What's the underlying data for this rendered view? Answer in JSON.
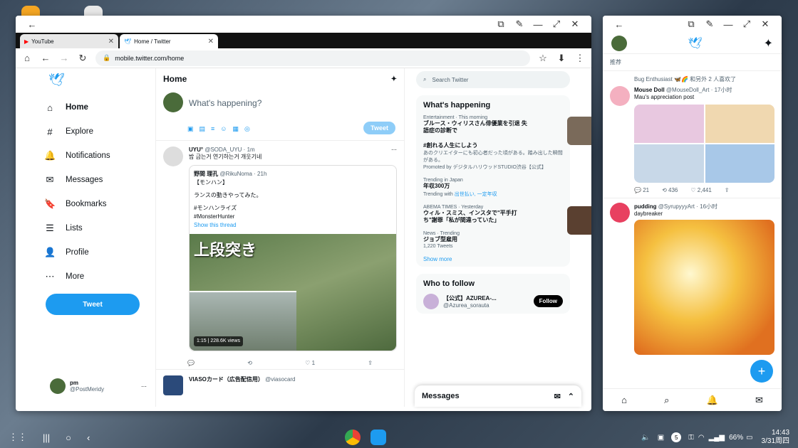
{
  "desktop": {
    "colors": {
      "accent": "#1d9bf0"
    }
  },
  "browser": {
    "tabs": [
      {
        "title": "YouTube",
        "icon": "youtube-icon"
      },
      {
        "title": "Home / Twitter",
        "icon": "twitter-icon"
      }
    ],
    "url": "mobile.twitter.com/home"
  },
  "twitter": {
    "nav": [
      "Home",
      "Explore",
      "Notifications",
      "Messages",
      "Bookmarks",
      "Lists",
      "Profile",
      "More"
    ],
    "tweet_button": "Tweet",
    "me": {
      "name": "pm",
      "handle": "@PostMeridy"
    },
    "feed_title": "Home",
    "compose_placeholder": "What's happening?",
    "compose_button": "Tweet",
    "tweet1": {
      "name": "UYU°",
      "handle": "@SODA_UYU · 1m",
      "text": "밤 금는거 연기하는거 개웃기네"
    },
    "quote": {
      "name": "野間 理孔",
      "handle": "@RikuNoma · 21h",
      "l1": "【モンハン】",
      "l2": "ランスの動きやってみた。",
      "l3": "#モンハンライズ",
      "l4": "#MonsterHunter",
      "show": "Show this thread",
      "overlay": "上段突き",
      "views": "1:15 | 228.6K views"
    },
    "tweet1_actions": {
      "likes": "1"
    },
    "tweet2": {
      "name": "VIASOカード（広告配信用）",
      "handle": "@viasocard"
    },
    "search_placeholder": "Search Twitter",
    "whats_happening": "What's happening",
    "trends": [
      {
        "sub": "Entertainment · This morning",
        "title": "ブルース・ウィリスさん俳優業を引退 失語症の診断で"
      },
      {
        "sub": "",
        "title": "#創れる人生にしよう",
        "desc": "あのクリエイターにも初心者だった頃がある。踏み出した瞬間がある。",
        "promo": "Promoted by デジタルハリウッドSTUDIO渋谷【公式】"
      },
      {
        "sub": "Trending in Japan",
        "title": "年収300万",
        "desc": "Trending with",
        "desc_link": "出世払い, 一定年収"
      },
      {
        "sub": "ABEMA TIMES · Yesterday",
        "title": "ウィル・スミス、インスタで\"平手打ち\"謝罪「私が間違っていた」"
      },
      {
        "sub": "News · Trending",
        "title": "ジョブ型雇用",
        "desc": "1,220 Tweets"
      }
    ],
    "show_more": "Show more",
    "who_to_follow": "Who to follow",
    "follow": {
      "name": "【公式】AZUREA-...",
      "handle": "@Azurea_sorauta",
      "button": "Follow"
    },
    "messages": "Messages"
  },
  "mobile": {
    "top_label": "推荐",
    "liked": "Bug Enthusiast 🦋🌈 和另外 2 人喜欢了",
    "t1": {
      "name": "Mouse Doll",
      "handle": "@MouseDoll_Art · 17小时",
      "text": "Mau's appreciation post",
      "stats": {
        "reply": "21",
        "rt": "436",
        "like": "2,441"
      }
    },
    "t2": {
      "name": "pudding",
      "handle": "@SyrupyyyArt · 16小时",
      "text": "daybreaker"
    }
  },
  "taskbar": {
    "time": "14:43",
    "date": "3/31周四",
    "battery": "66%",
    "badge": "5"
  }
}
